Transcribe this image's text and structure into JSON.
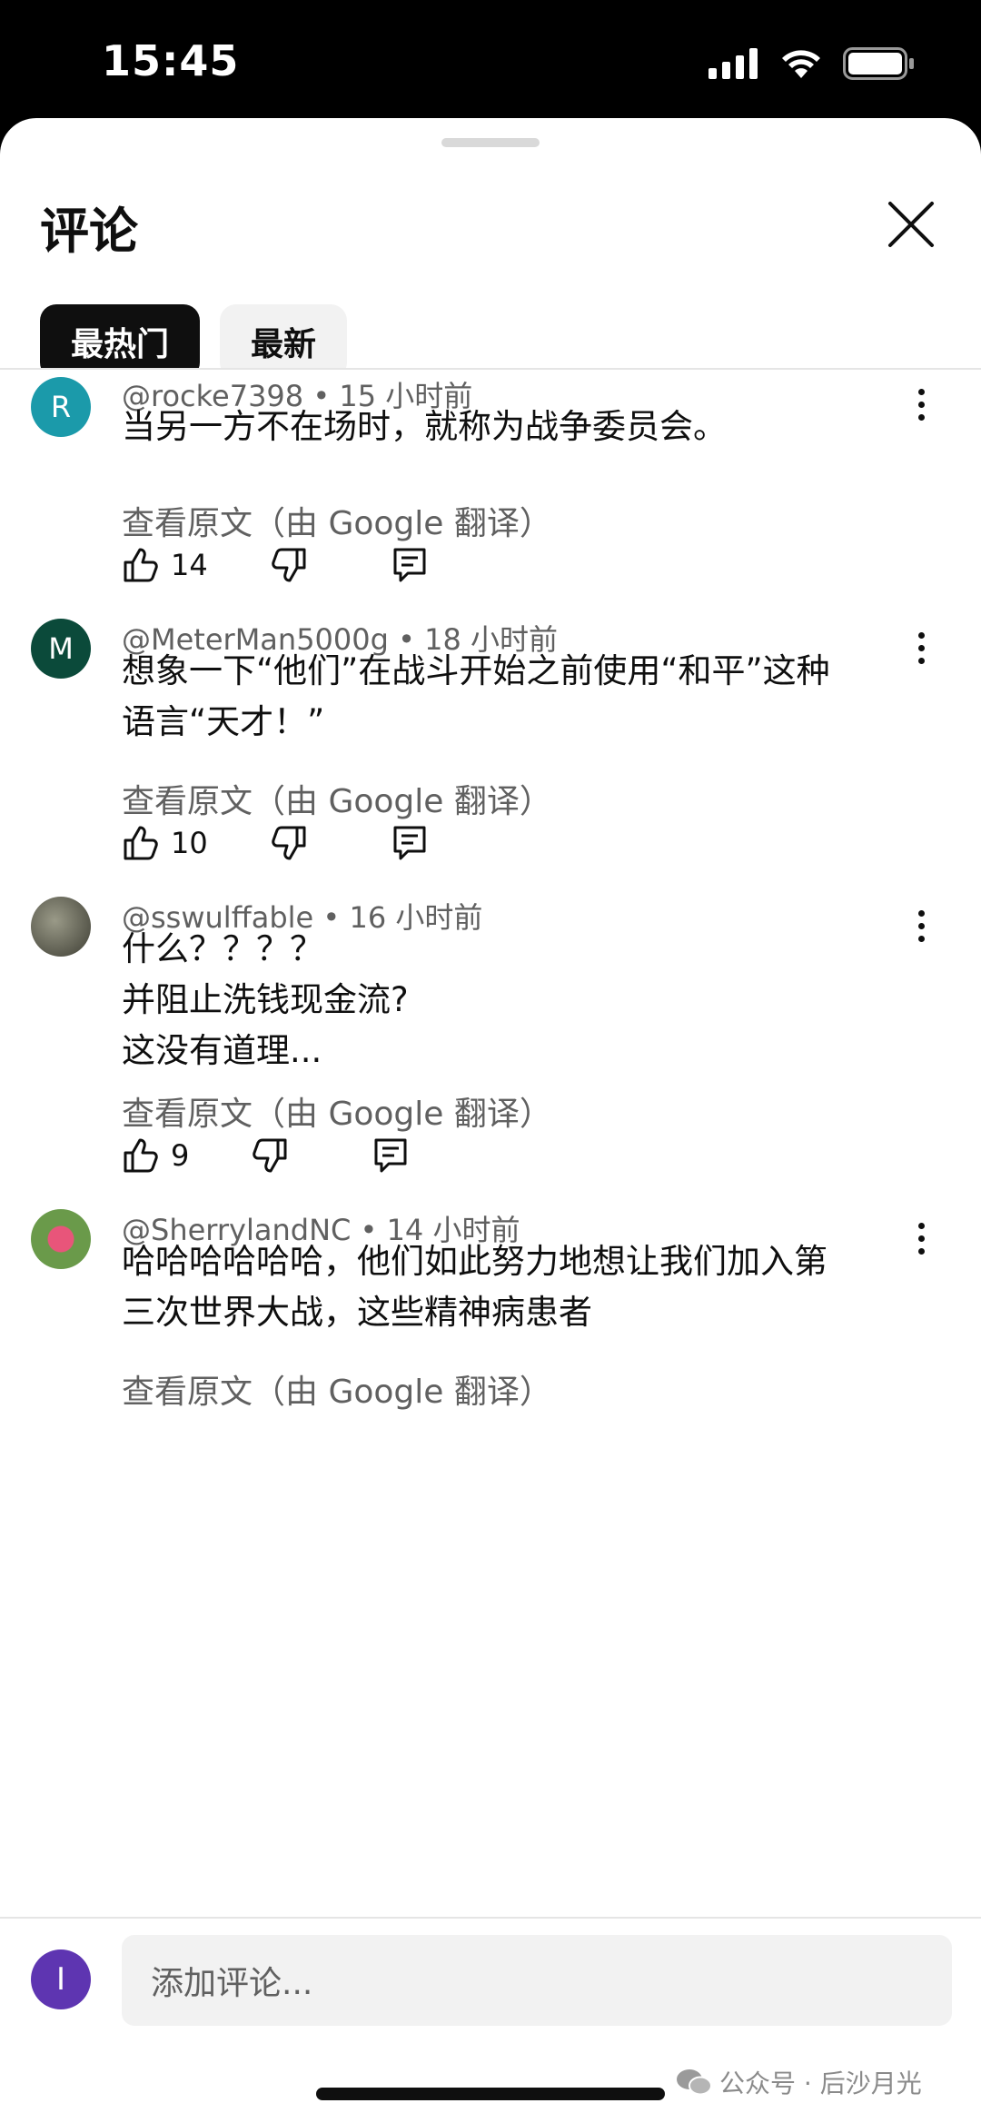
{
  "status_bar": {
    "time": "15:45"
  },
  "sheet": {
    "title": "评论"
  },
  "tabs": [
    {
      "label": "最热门",
      "active": true
    },
    {
      "label": "最新",
      "active": false
    }
  ],
  "comments": [
    {
      "avatar_letter": "R",
      "avatar_color": "#1b9aaa",
      "author": "@rocke7398",
      "time": "15 小时前",
      "lines": [
        "当另一方不在场时，就称为战争委员会。"
      ],
      "translate": "查看原文（由 Google 翻译）",
      "likes": "14"
    },
    {
      "avatar_letter": "M",
      "avatar_color": "#0b4a3a",
      "author": "@MeterMan5000g",
      "time": "18 小时前",
      "lines": [
        "想象一下“他们”在战斗开始之前使用“和平”这种",
        "语言“天才！”"
      ],
      "translate": "查看原文（由 Google 翻译）",
      "likes": "10"
    },
    {
      "avatar_letter": "",
      "avatar_color": "#6b6b5a",
      "author": "@sswulffable",
      "time": "16 小时前",
      "lines": [
        "什么？？？？",
        "并阻止洗钱现金流?",
        "这没有道理..."
      ],
      "translate": "查看原文（由 Google 翻译）",
      "likes": "9"
    },
    {
      "avatar_letter": "",
      "avatar_color": "#7aa35a",
      "author": "@SherrylandNC",
      "time": "14 小时前",
      "lines": [
        "哈哈哈哈哈哈，他们如此努力地想让我们加入第",
        "三次世界大战，这些精神病患者"
      ],
      "translate": "查看原文（由 Google 翻译）",
      "likes": ""
    }
  ],
  "composer": {
    "avatar_letter": "I",
    "placeholder": "添加评论..."
  },
  "watermark": "公众号 · 后沙月光"
}
